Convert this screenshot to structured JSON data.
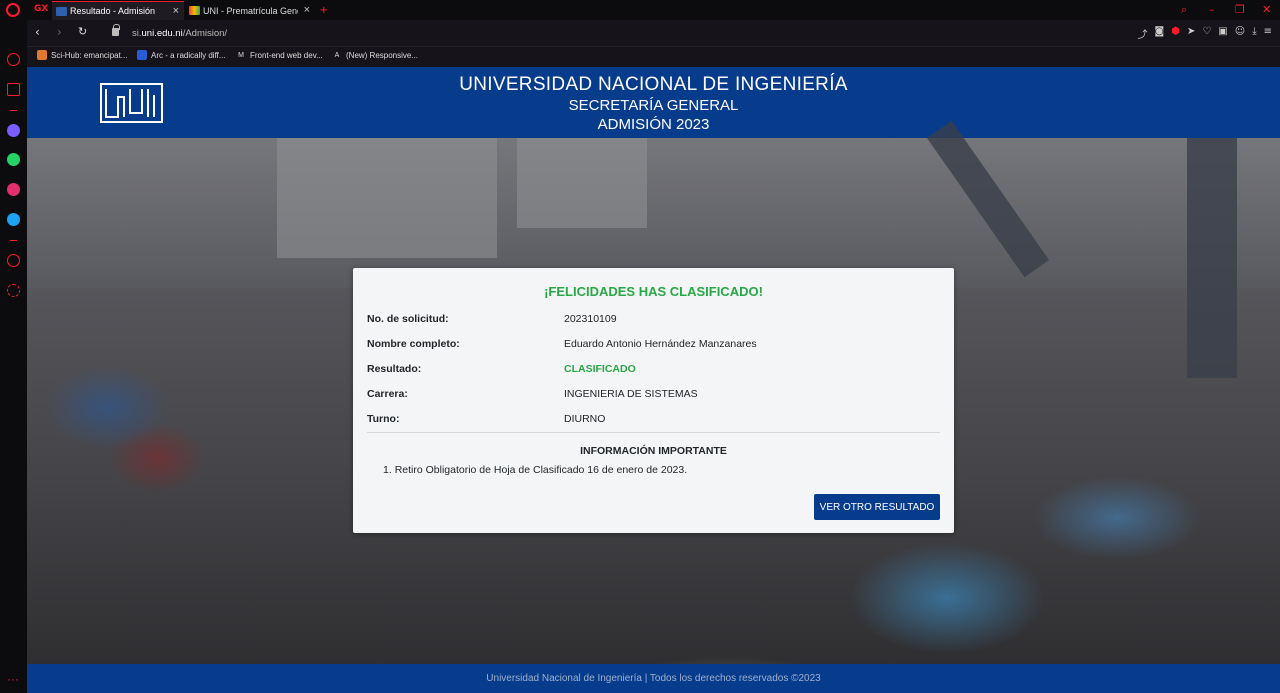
{
  "browser": {
    "tabs": [
      {
        "title": "Resultado - Admisión",
        "active": true
      },
      {
        "title": "UNI - Prematrícula General"
      }
    ],
    "new_tab": "+",
    "url_prefix": "si.",
    "url_domain": "uni.edu.ni",
    "url_path": "/Admision/",
    "bookmarks": [
      "Sci-Hub: emancipat...",
      "Arc - a radically diff...",
      "Front-end web dev...",
      "(New) Responsive..."
    ],
    "accent_color": "#ff1b2d"
  },
  "header": {
    "university": "UNIVERSIDAD NACIONAL DE INGENIERÍA",
    "department": "SECRETARÍA GENERAL",
    "process": "ADMISIÓN 2023",
    "brand_color": "#073b8c"
  },
  "result": {
    "title": "¡FELICIDADES HAS CLASIFICADO!",
    "fields": [
      {
        "label": "No. de solicitud:",
        "value": "202310109"
      },
      {
        "label": "Nombre completo:",
        "value": "Eduardo Antonio Hernández Manzanares"
      },
      {
        "label": "Resultado:",
        "value": "CLASIFICADO"
      },
      {
        "label": "Carrera:",
        "value": "INGENIERIA DE SISTEMAS"
      },
      {
        "label": "Turno:",
        "value": "DIURNO"
      }
    ],
    "info_title": "INFORMACIÓN IMPORTANTE",
    "info_items": [
      "Retiro Obligatorio de Hoja de Clasificado 16 de enero de 2023."
    ],
    "button_label": "VER OTRO RESULTADO",
    "success_color": "#28a745"
  },
  "footer": {
    "text": "Universidad Nacional de Ingeniería | Todos los derechos reservados ©2023"
  }
}
